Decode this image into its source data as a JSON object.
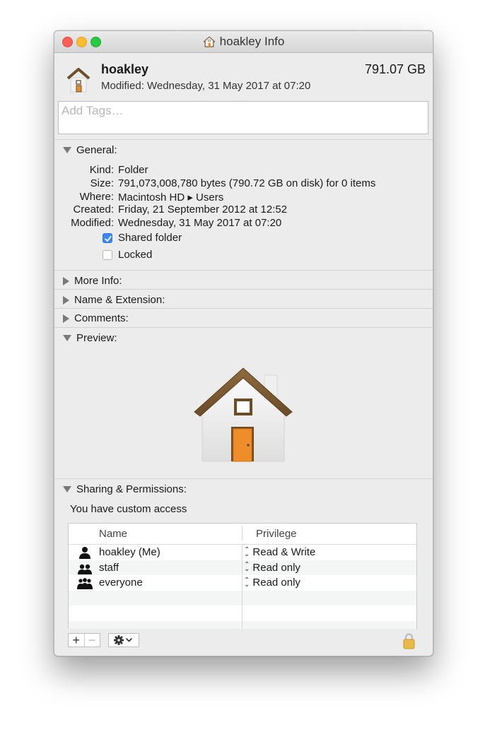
{
  "window": {
    "title": "hoakley Info"
  },
  "header": {
    "name": "hoakley",
    "size": "791.07 GB",
    "modified_label": "Modified:",
    "modified_value": "Wednesday, 31 May 2017 at 07:20"
  },
  "tags": {
    "placeholder": "Add Tags…"
  },
  "general": {
    "title": "General:",
    "rows": [
      {
        "label": "Kind:",
        "value": "Folder"
      },
      {
        "label": "Size:",
        "value": "791,073,008,780 bytes (790.72 GB on disk) for 0 items"
      },
      {
        "label": "Where:",
        "value": "Macintosh HD ▸ Users"
      },
      {
        "label": "Created:",
        "value": "Friday, 21 September 2012 at 12:52"
      },
      {
        "label": "Modified:",
        "value": "Wednesday, 31 May 2017 at 07:20"
      }
    ],
    "shared_folder": {
      "label": "Shared folder",
      "checked": true
    },
    "locked": {
      "label": "Locked",
      "checked": false
    }
  },
  "sections": {
    "more_info": "More Info:",
    "name_extension": "Name & Extension:",
    "comments": "Comments:",
    "preview": "Preview:",
    "sharing": "Sharing & Permissions:"
  },
  "sharing": {
    "access_text": "You have custom access",
    "columns": {
      "name": "Name",
      "privilege": "Privilege"
    },
    "rows": [
      {
        "name": "hoakley (Me)",
        "privilege": "Read & Write",
        "icon": "single-user-icon"
      },
      {
        "name": "staff",
        "privilege": "Read only",
        "icon": "group-icon"
      },
      {
        "name": "everyone",
        "privilege": "Read only",
        "icon": "everyone-icon"
      }
    ]
  },
  "toolbar": {
    "add": "+",
    "remove": "−"
  },
  "colors": {
    "checkbox_accent": "#3d87f2",
    "close": "#fc5f57",
    "minimize": "#fdbc2e",
    "zoom": "#28c840"
  }
}
